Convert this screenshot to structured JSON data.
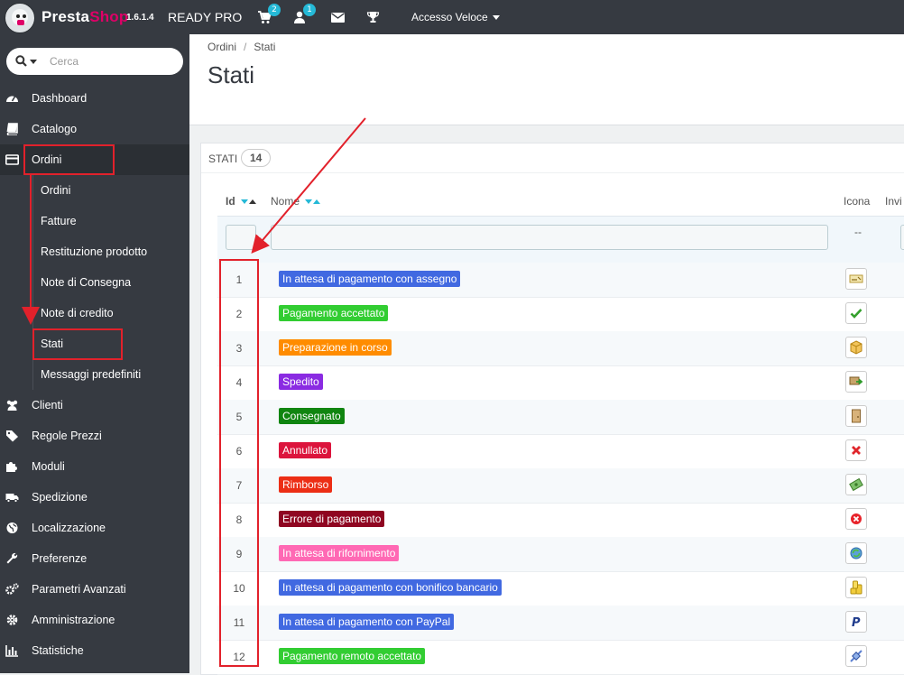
{
  "app": {
    "brand_a": "Presta",
    "brand_b": "Shop",
    "version": "1.6.1.4",
    "shop_name": "READY PRO",
    "cart_badge": "2",
    "user_badge": "1",
    "quick_access": "Accesso Veloce"
  },
  "search": {
    "placeholder": "Cerca"
  },
  "sidebar": {
    "items": [
      {
        "label": "Dashboard",
        "icon": "dashboard-icon"
      },
      {
        "label": "Catalogo",
        "icon": "book-icon"
      },
      {
        "label": "Ordini",
        "icon": "credit-card-icon",
        "active": true
      },
      {
        "label": "Clienti",
        "icon": "users-icon"
      },
      {
        "label": "Regole Prezzi",
        "icon": "tags-icon"
      },
      {
        "label": "Moduli",
        "icon": "puzzle-icon"
      },
      {
        "label": "Spedizione",
        "icon": "truck-icon"
      },
      {
        "label": "Localizzazione",
        "icon": "globe-icon"
      },
      {
        "label": "Preferenze",
        "icon": "wrench-icon"
      },
      {
        "label": "Parametri Avanzati",
        "icon": "cogs-icon"
      },
      {
        "label": "Amministrazione",
        "icon": "gear-icon"
      },
      {
        "label": "Statistiche",
        "icon": "bar-chart-icon"
      }
    ],
    "sub_items": [
      {
        "label": "Ordini"
      },
      {
        "label": "Fatture"
      },
      {
        "label": "Restituzione prodotto"
      },
      {
        "label": "Note di Consegna"
      },
      {
        "label": "Note di credito"
      },
      {
        "label": "Stati",
        "current": true
      },
      {
        "label": "Messaggi predefiniti"
      }
    ]
  },
  "breadcrumb": {
    "parent": "Ordini",
    "separator": "/",
    "current": "Stati"
  },
  "page": {
    "title": "Stati"
  },
  "panel": {
    "title": "Stati",
    "count": "14"
  },
  "table": {
    "columns": {
      "id": "Id",
      "name": "Nome",
      "icon": "Icona",
      "send": "Invi"
    },
    "filter_dash": "--",
    "rows": [
      {
        "id": "1",
        "name": "In attesa di pagamento con assegno",
        "color": "#4169e1",
        "icon": "cheque-icon"
      },
      {
        "id": "2",
        "name": "Pagamento accettato",
        "color": "#32cd32",
        "icon": "check-icon"
      },
      {
        "id": "3",
        "name": "Preparazione in corso",
        "color": "#ff8c00",
        "icon": "package-icon"
      },
      {
        "id": "4",
        "name": "Spedito",
        "color": "#8a2be2",
        "icon": "delivery-icon"
      },
      {
        "id": "5",
        "name": "Consegnato",
        "color": "#108510",
        "icon": "door-icon"
      },
      {
        "id": "6",
        "name": "Annullato",
        "color": "#dc143c",
        "icon": "cross-icon"
      },
      {
        "id": "7",
        "name": "Rimborso",
        "color": "#ec2e15",
        "icon": "money-icon"
      },
      {
        "id": "8",
        "name": "Errore di pagamento",
        "color": "#8f0621",
        "icon": "error-icon"
      },
      {
        "id": "9",
        "name": "In attesa di rifornimento",
        "color": "#ff69b4",
        "icon": "refresh-icon"
      },
      {
        "id": "10",
        "name": "In attesa di pagamento con bonifico bancario",
        "color": "#4169e1",
        "icon": "coins-icon"
      },
      {
        "id": "11",
        "name": "In attesa di pagamento con PayPal",
        "color": "#4169e1",
        "icon": "paypal-icon"
      },
      {
        "id": "12",
        "name": "Pagamento remoto accettato",
        "color": "#32cd32",
        "icon": "remote-icon"
      }
    ]
  }
}
